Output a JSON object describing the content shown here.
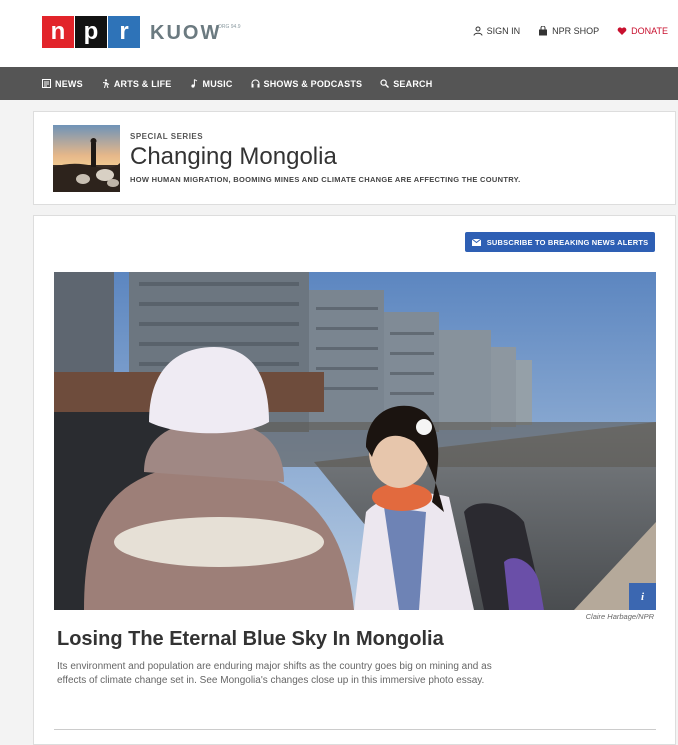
{
  "header": {
    "logo_letters": [
      "n",
      "p",
      "r"
    ],
    "station": "KUOW",
    "station_sub": "ORG 94.9",
    "links": [
      {
        "label": "SIGN IN",
        "icon": "user-icon"
      },
      {
        "label": "NPR SHOP",
        "icon": "bag-icon"
      },
      {
        "label": "DONATE",
        "icon": "heart-icon"
      }
    ]
  },
  "nav": {
    "items": [
      {
        "label": "NEWS",
        "icon": "news-icon"
      },
      {
        "label": "ARTS & LIFE",
        "icon": "arts-icon"
      },
      {
        "label": "MUSIC",
        "icon": "music-icon"
      },
      {
        "label": "SHOWS & PODCASTS",
        "icon": "headphones-icon"
      },
      {
        "label": "SEARCH",
        "icon": "search-icon"
      }
    ]
  },
  "series": {
    "eyebrow": "SPECIAL SERIES",
    "title": "Changing Mongolia",
    "description": "HOW HUMAN MIGRATION, BOOMING MINES AND CLIMATE CHANGE ARE AFFECTING THE COUNTRY."
  },
  "main": {
    "subscribe_label": "SUBSCRIBE TO BREAKING NEWS ALERTS",
    "photo_credit": "Claire Harbage/NPR",
    "info_label": "i",
    "story_title": "Losing The Eternal Blue Sky In Mongolia",
    "story_teaser": "Its environment and population are enduring major shifts as the country goes big on mining and as effects of climate change set in. See Mongolia's changes close up in this immersive photo essay."
  },
  "colors": {
    "npr_red": "#e2242a",
    "npr_black": "#121212",
    "npr_blue": "#2e73b8",
    "nav_bg": "#555555",
    "button_blue": "#2e5fb4",
    "donate_red": "#c8102e"
  }
}
